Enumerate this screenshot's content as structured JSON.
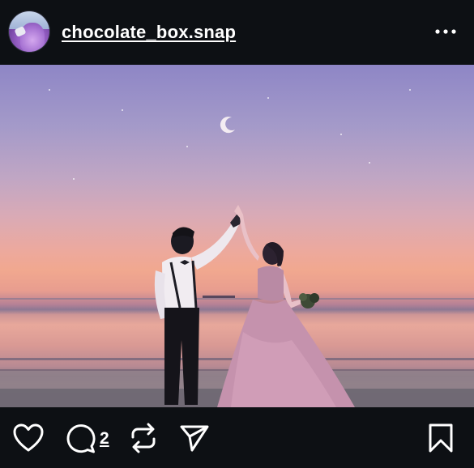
{
  "post": {
    "username": "chocolate_box.snap",
    "avatar_icon": "avatar-photo",
    "more_icon": "more-horizontal-icon",
    "photo_description_icon": "post-photo"
  },
  "actions": {
    "like_icon": "heart-icon",
    "comment_icon": "comment-icon",
    "comment_count": "2",
    "repost_icon": "repost-icon",
    "share_icon": "send-icon",
    "save_icon": "bookmark-icon"
  },
  "colors": {
    "background": "#0d1014",
    "text": "#ffffff"
  }
}
